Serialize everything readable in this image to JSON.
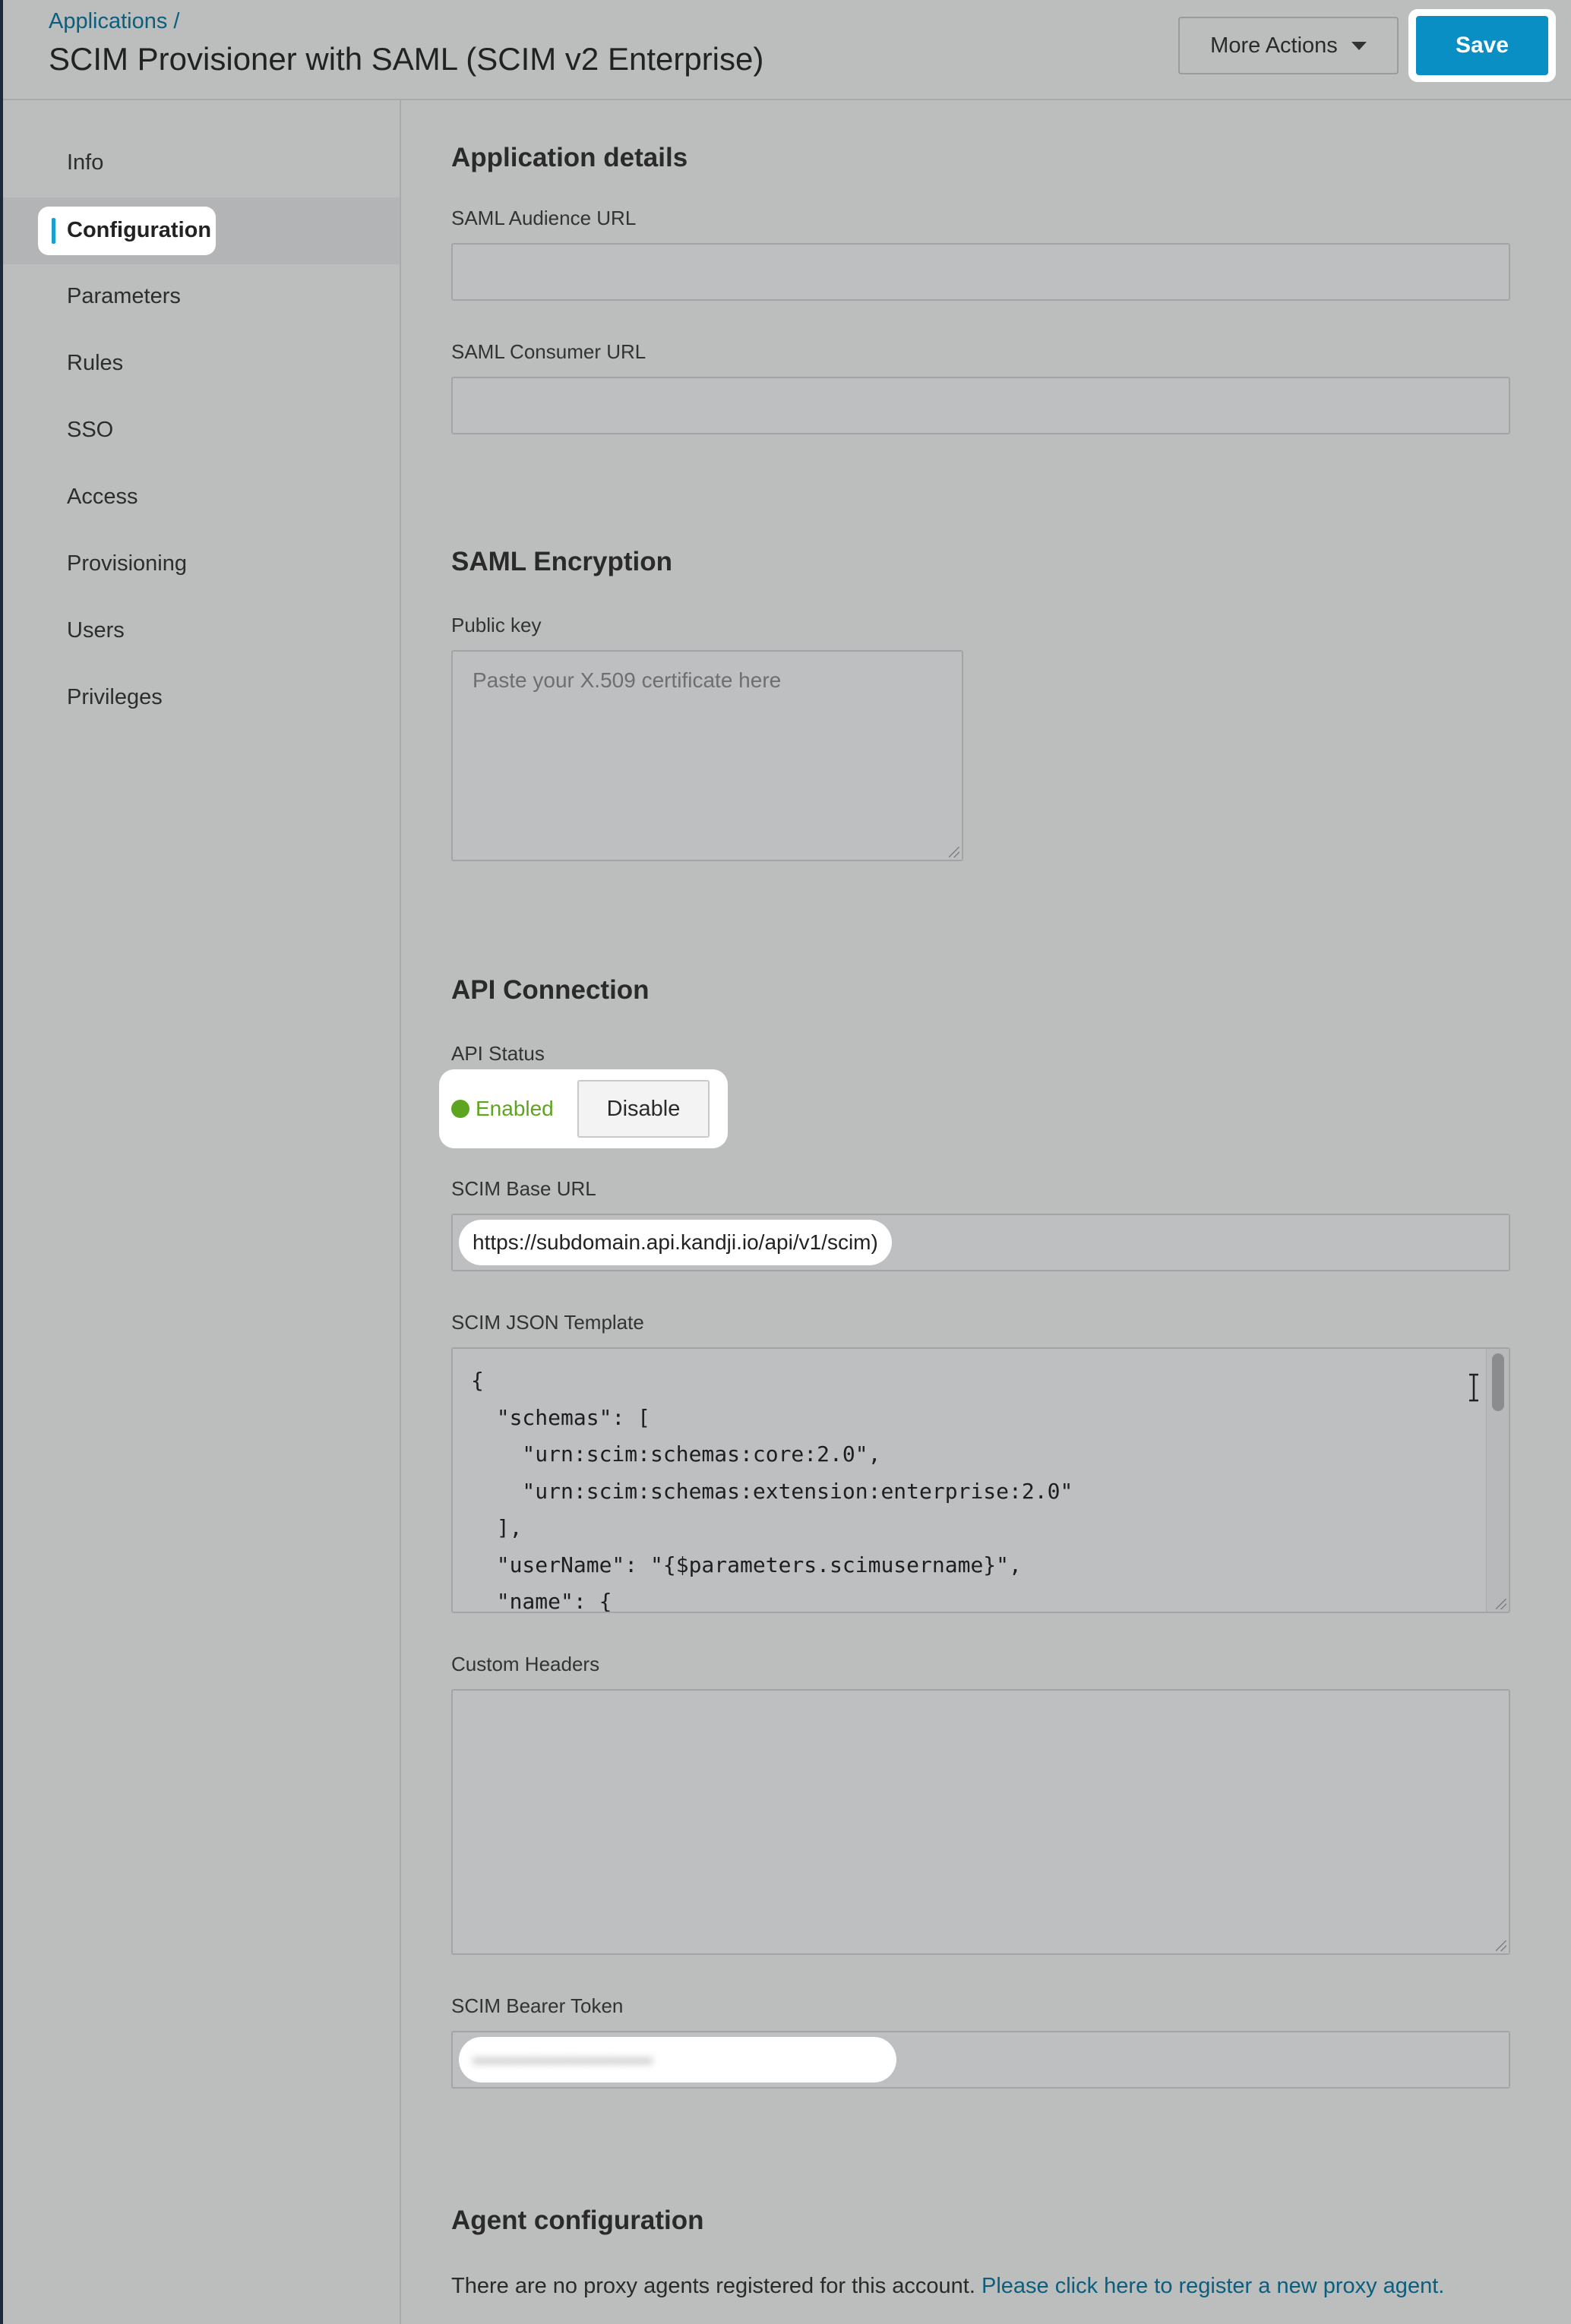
{
  "header": {
    "breadcrumb": "Applications /",
    "title": "SCIM Provisioner with SAML (SCIM v2 Enterprise)",
    "more_actions_label": "More Actions",
    "save_label": "Save"
  },
  "sidebar": {
    "items": [
      {
        "label": "Info"
      },
      {
        "label": "Configuration",
        "active": true
      },
      {
        "label": "Parameters"
      },
      {
        "label": "Rules"
      },
      {
        "label": "SSO"
      },
      {
        "label": "Access"
      },
      {
        "label": "Provisioning"
      },
      {
        "label": "Users"
      },
      {
        "label": "Privileges"
      }
    ]
  },
  "application_details": {
    "title": "Application details",
    "audience_label": "SAML Audience URL",
    "audience_value": "",
    "consumer_label": "SAML Consumer URL",
    "consumer_value": ""
  },
  "saml_encryption": {
    "title": "SAML Encryption",
    "public_key_label": "Public key",
    "public_key_placeholder": "Paste your X.509 certificate here"
  },
  "api_connection": {
    "title": "API Connection",
    "status_label": "API Status",
    "status_value": "Enabled",
    "status_color": "#5ea51f",
    "disable_label": "Disable",
    "base_url_label": "SCIM Base URL",
    "base_url_value": "https://subdomain.api.kandji.io/api/v1/scim)",
    "json_label": "SCIM JSON Template",
    "json_value": "{\n  \"schemas\": [\n    \"urn:scim:schemas:core:2.0\",\n    \"urn:scim:schemas:extension:enterprise:2.0\"\n  ],\n  \"userName\": \"{$parameters.scimusername}\",\n  \"name\": {",
    "custom_headers_label": "Custom Headers",
    "custom_headers_value": "",
    "bearer_token_label": "SCIM Bearer Token",
    "bearer_token_value": "••••••••••••••••••••••••••"
  },
  "agent_configuration": {
    "title": "Agent configuration",
    "message": "There are no proxy agents registered for this account.",
    "link_text": "Please click here to register a new proxy agent."
  },
  "colors": {
    "accent": "#0a8fc4",
    "link": "#0b5e7e",
    "active_indicator": "#1aa0cf"
  }
}
